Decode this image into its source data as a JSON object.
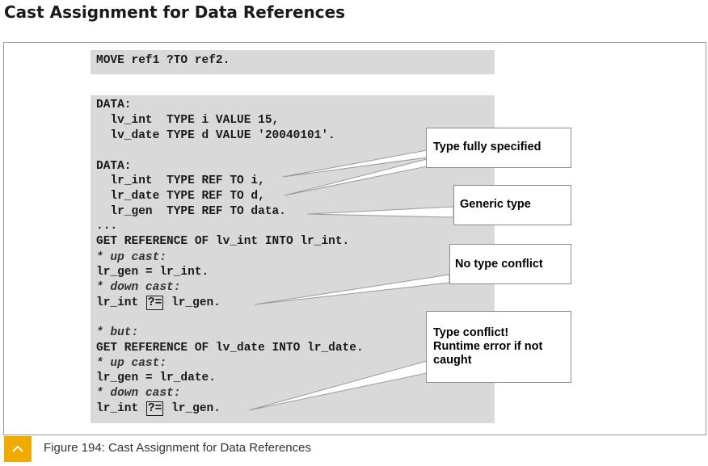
{
  "title": "Cast Assignment for Data References",
  "code_top": "MOVE ref1 ?TO ref2.",
  "code": {
    "l1": "DATA:",
    "l2": "  lv_int  TYPE i VALUE 15,",
    "l3": "  lv_date TYPE d VALUE '20040101'.",
    "l4": "DATA:",
    "l5": "  lr_int  TYPE REF TO i,",
    "l6": "  lr_date TYPE REF TO d,",
    "l7": "  lr_gen  TYPE REF TO data.",
    "l8": "...",
    "l9": "GET REFERENCE OF lv_int INTO lr_int.",
    "l10": "* up cast:",
    "l11": "lr_gen = lr_int.",
    "l12": "* down cast:",
    "l13a": "lr_int ",
    "l13b": "?=",
    "l13c": " lr_gen.",
    "l14": "* but:",
    "l15": "GET REFERENCE OF lv_date INTO lr_date.",
    "l16": "* up cast:",
    "l17": "lr_gen = lr_date.",
    "l18": "* down cast:",
    "l19a": "lr_int ",
    "l19b": "?=",
    "l19c": " lr_gen."
  },
  "callouts": {
    "type_fully_specified": "Type fully specified",
    "generic_type": "Generic type",
    "no_type_conflict": "No type conflict",
    "type_conflict": "Type conflict!\nRuntime error if not\ncaught"
  },
  "caption": "Figure 194: Cast Assignment for Data References",
  "colors": {
    "accent": "#f0ab00",
    "code_bg": "#d9d9d9"
  },
  "icons": {
    "caption_toggle": "chevron-up-icon"
  }
}
